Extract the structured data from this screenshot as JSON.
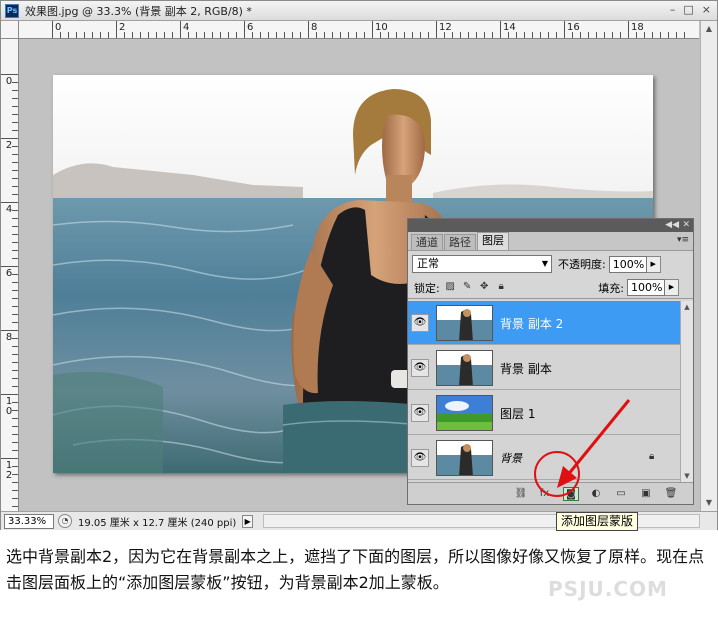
{
  "window": {
    "title": "效果图.jpg @ 33.3% (背景 副本 2, RGB/8) *",
    "logo_text": "Ps",
    "minimize": "–",
    "maximize": "□",
    "close": "×"
  },
  "ruler": {
    "top_labels": [
      "0",
      "2",
      "4",
      "6",
      "8",
      "10",
      "12",
      "14",
      "16",
      "18"
    ],
    "left_labels": [
      "0",
      "2",
      "4",
      "6",
      "8",
      "1\n0",
      "1\n2"
    ]
  },
  "status": {
    "zoom": "33.33%",
    "doc_info": "19.05 厘米 x 12.7 厘米 (240 ppi)",
    "arrow": "▶"
  },
  "layers_panel": {
    "tabs": [
      {
        "label": "通道",
        "active": false
      },
      {
        "label": "路径",
        "active": false
      },
      {
        "label": "图层",
        "active": true
      }
    ],
    "blend_mode": "正常",
    "opacity_label": "不透明度:",
    "opacity_value": "100%",
    "lock_label": "锁定:",
    "fill_label": "填充:",
    "fill_value": "100%",
    "layers": [
      {
        "name": "背景 副本 2",
        "selected": true,
        "visible": true,
        "locked": false
      },
      {
        "name": "背景 副本",
        "selected": false,
        "visible": true,
        "locked": false
      },
      {
        "name": "图层 1",
        "selected": false,
        "visible": true,
        "locked": false
      },
      {
        "name": "背景",
        "selected": false,
        "visible": true,
        "locked": true
      }
    ],
    "bottom_icons": [
      "link-icon",
      "fx-icon",
      "add-mask-icon",
      "adjustment-icon",
      "group-icon",
      "new-layer-icon",
      "trash-icon"
    ],
    "fx_text": "fx."
  },
  "tooltip": {
    "text": "添加图层蒙版"
  },
  "caption": {
    "text": "选中背景副本2，因为它在背景副本之上，遮挡了下面的图层，所以图像好像又恢复了原样。现在点击图层面板上的“添加图层蒙板”按钮，为背景副本2加上蒙板。"
  },
  "watermark": {
    "text": "PSJU.COM"
  },
  "colors": {
    "selected_layer": "#3d9bf3",
    "annotation_red": "#e01010",
    "canvas_bg": "#c2c2c2"
  }
}
